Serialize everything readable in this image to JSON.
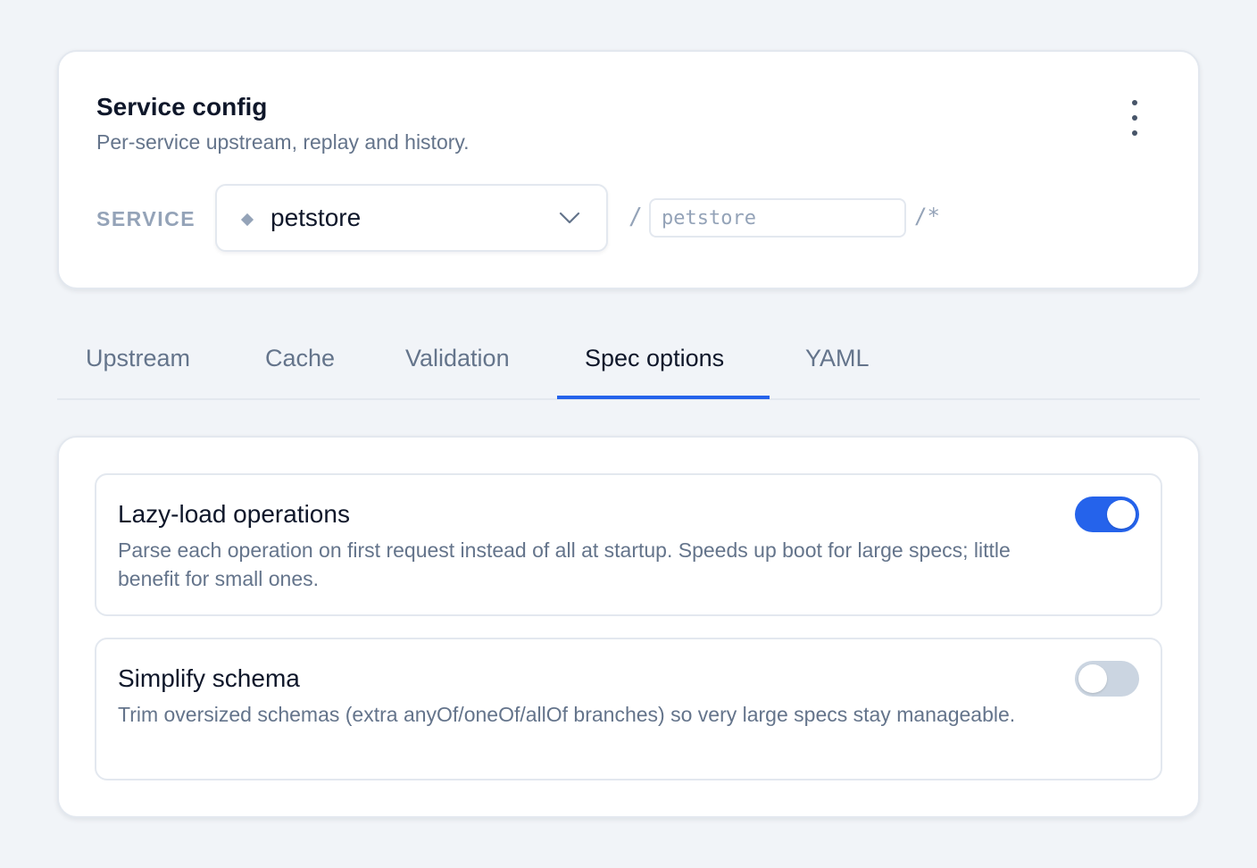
{
  "header": {
    "title": "Service config",
    "subtitle": "Per-service upstream, replay and history.",
    "menu_icon": "more-vertical-icon",
    "service_label": "SERVICE",
    "service_select": {
      "value": "petstore",
      "icon": "diamond-icon",
      "chevron": "chevron-down-icon"
    },
    "path_prefix": "/",
    "path_input": {
      "value": "",
      "placeholder": "petstore"
    },
    "path_suffix": "/*"
  },
  "tabs": [
    {
      "label": "Upstream",
      "active": false
    },
    {
      "label": "Cache",
      "active": false
    },
    {
      "label": "Validation",
      "active": false
    },
    {
      "label": "Spec options",
      "active": true
    },
    {
      "label": "YAML",
      "active": false
    }
  ],
  "options": [
    {
      "title": "Lazy-load operations",
      "description": "Parse each operation on first request instead of all at startup. Speeds up boot for large specs; little benefit for small ones.",
      "enabled": true
    },
    {
      "title": "Simplify schema",
      "description": "Trim oversized schemas (extra anyOf/oneOf/allOf branches) so very large specs stay manageable.",
      "enabled": false
    }
  ],
  "colors": {
    "accent": "#2563eb",
    "toggle_off": "#cbd5e1",
    "muted_text": "#64748b",
    "border": "#e3e8ef",
    "background": "#f1f4f8"
  }
}
